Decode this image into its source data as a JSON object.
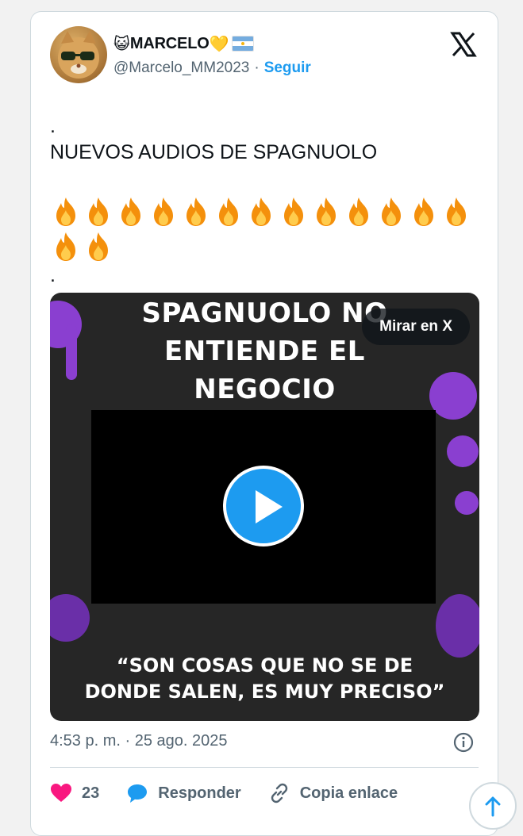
{
  "user": {
    "display_name": "MARCELO",
    "name_prefix_emoji": "😺",
    "name_suffix_emoji": "💛",
    "handle": "@Marcelo_MM2023",
    "separator": "·",
    "follow_label": "Seguir"
  },
  "tweet": {
    "line1": ".",
    "line2": "NUEVOS AUDIOS DE SPAGNUOLO",
    "fire_count": 15,
    "line_end": "."
  },
  "media": {
    "title_lines": [
      "SPAGNUOLO NO",
      "ENTIENDE EL",
      "NEGOCIO"
    ],
    "quote_lines": [
      "“SON COSAS QUE NO SE DE",
      "DONDE SALEN, ES MUY PRECISO”"
    ],
    "watch_label": "Mirar en X"
  },
  "meta": {
    "timestamp": "4:53 p. m. · 25 ago. 2025"
  },
  "actions": {
    "likes": "23",
    "reply_label": "Responder",
    "copy_label": "Copia enlace"
  },
  "colors": {
    "accent": "#1d9bf0",
    "like": "#f91880",
    "splatter": "#8a3fd0"
  },
  "icons": [
    "x-logo-icon",
    "fire-icon",
    "play-icon",
    "info-icon",
    "heart-icon",
    "reply-bubble-icon",
    "link-icon",
    "arrow-up-icon"
  ]
}
